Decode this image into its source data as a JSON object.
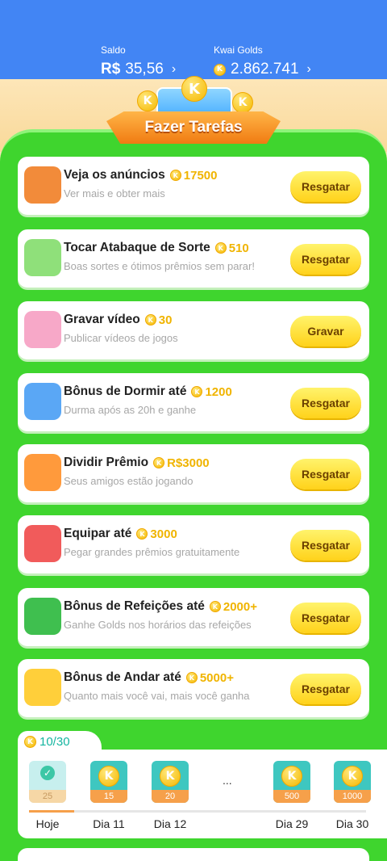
{
  "header": {
    "saldo_label": "Saldo",
    "saldo_currency": "R$",
    "saldo_value": "35,56",
    "golds_label": "Kwai Golds",
    "golds_value": "2.862.741",
    "chevron": "›"
  },
  "banner": {
    "title": "Fazer Tarefas",
    "coin_letter": "K"
  },
  "tasks": [
    {
      "title": "Veja os anúncios",
      "reward": "17500",
      "subtitle": "Ver mais e obter mais",
      "button": "Resgatar",
      "icon": "tv-icon"
    },
    {
      "title": "Tocar Atabaque de Sorte",
      "reward": "510",
      "subtitle": "Boas sortes e ótimos prêmios sem parar!",
      "button": "Resgatar",
      "icon": "drum-icon"
    },
    {
      "title": "Gravar vídeo",
      "reward": "30",
      "subtitle": "Publicar vídeos de jogos",
      "button": "Gravar",
      "icon": "gamepad-icon"
    },
    {
      "title": "Bônus de Dormir até",
      "reward": "1200",
      "subtitle": "Durma após as 20h e ganhe",
      "button": "Resgatar",
      "icon": "moon-icon"
    },
    {
      "title": "Dividir Prêmio",
      "reward": "R$3000",
      "subtitle": "Seus amigos estão jogando",
      "button": "Resgatar",
      "icon": "gift-icon"
    },
    {
      "title": "Equipar até",
      "reward": "3000",
      "subtitle": "Pegar grandes prêmios gratuitamente",
      "button": "Resgatar",
      "icon": "boxing-glove-icon"
    },
    {
      "title": "Bônus de Refeições até",
      "reward": "2000+",
      "subtitle": "Ganhe Golds nos horários das refeições",
      "button": "Resgatar",
      "icon": "lunchbox-icon"
    },
    {
      "title": "Bônus de Andar até",
      "reward": "5000+",
      "subtitle": "Quanto mais você vai, mais você ganha",
      "button": "Resgatar",
      "icon": "runner-icon"
    }
  ],
  "checkin": {
    "progress": "10/30",
    "ellipsis": "...",
    "days": [
      {
        "label": "Hoje",
        "amount": "25",
        "done": true
      },
      {
        "label": "Dia 11",
        "amount": "15",
        "done": false
      },
      {
        "label": "Dia 12",
        "amount": "20",
        "done": false
      },
      {
        "label": "Dia 29",
        "amount": "500",
        "done": false
      },
      {
        "label": "Dia 30",
        "amount": "1000",
        "done": false
      }
    ]
  },
  "colors": {
    "header_blue": "#4285f4",
    "panel_green": "#3fd52e",
    "coin_gold": "#f5b800",
    "button_yellow": "#ffd21a",
    "progress_teal": "#14b5a0"
  }
}
